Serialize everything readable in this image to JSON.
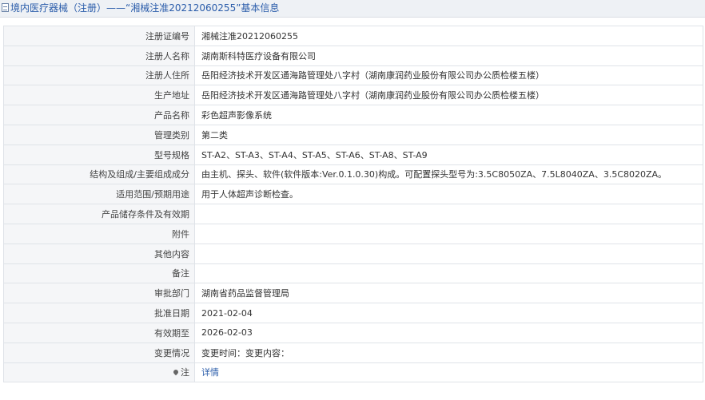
{
  "header": {
    "icon": "document-icon",
    "title": "境内医疗器械（注册）——“湘械注准20212060255”基本信息"
  },
  "rows": [
    {
      "label": "注册证编号",
      "value": "湘械注准20212060255"
    },
    {
      "label": "注册人名称",
      "value": "湖南斯科特医疗设备有限公司"
    },
    {
      "label": "注册人住所",
      "value": "岳阳经济技术开发区通海路管理处八字村（湖南康润药业股份有限公司办公质检楼五楼）"
    },
    {
      "label": "生产地址",
      "value": "岳阳经济技术开发区通海路管理处八字村（湖南康润药业股份有限公司办公质检楼五楼）"
    },
    {
      "label": "产品名称",
      "value": "彩色超声影像系统"
    },
    {
      "label": "管理类别",
      "value": "第二类"
    },
    {
      "label": "型号规格",
      "value": "ST-A2、ST-A3、ST-A4、ST-A5、ST-A6、ST-A8、ST-A9"
    },
    {
      "label": "结构及组成/主要组成成分",
      "value": "由主机、探头、软件(软件版本:Ver.0.1.0.30)构成。可配置探头型号为:3.5C8050ZA、7.5L8040ZA、3.5C8020ZA。"
    },
    {
      "label": "适用范围/预期用途",
      "value": "用于人体超声诊断检查。"
    },
    {
      "label": "产品储存条件及有效期",
      "value": ""
    },
    {
      "label": "附件",
      "value": ""
    },
    {
      "label": "其他内容",
      "value": ""
    },
    {
      "label": "备注",
      "value": ""
    },
    {
      "label": "审批部门",
      "value": "湖南省药品监督管理局"
    },
    {
      "label": "批准日期",
      "value": "2021-02-04"
    },
    {
      "label": "有效期至",
      "value": "2026-02-03"
    },
    {
      "label": "变更情况",
      "value": "变更时间：变更内容："
    }
  ],
  "note": {
    "label": "注",
    "icon": "location-pin-icon",
    "link": "详情"
  }
}
